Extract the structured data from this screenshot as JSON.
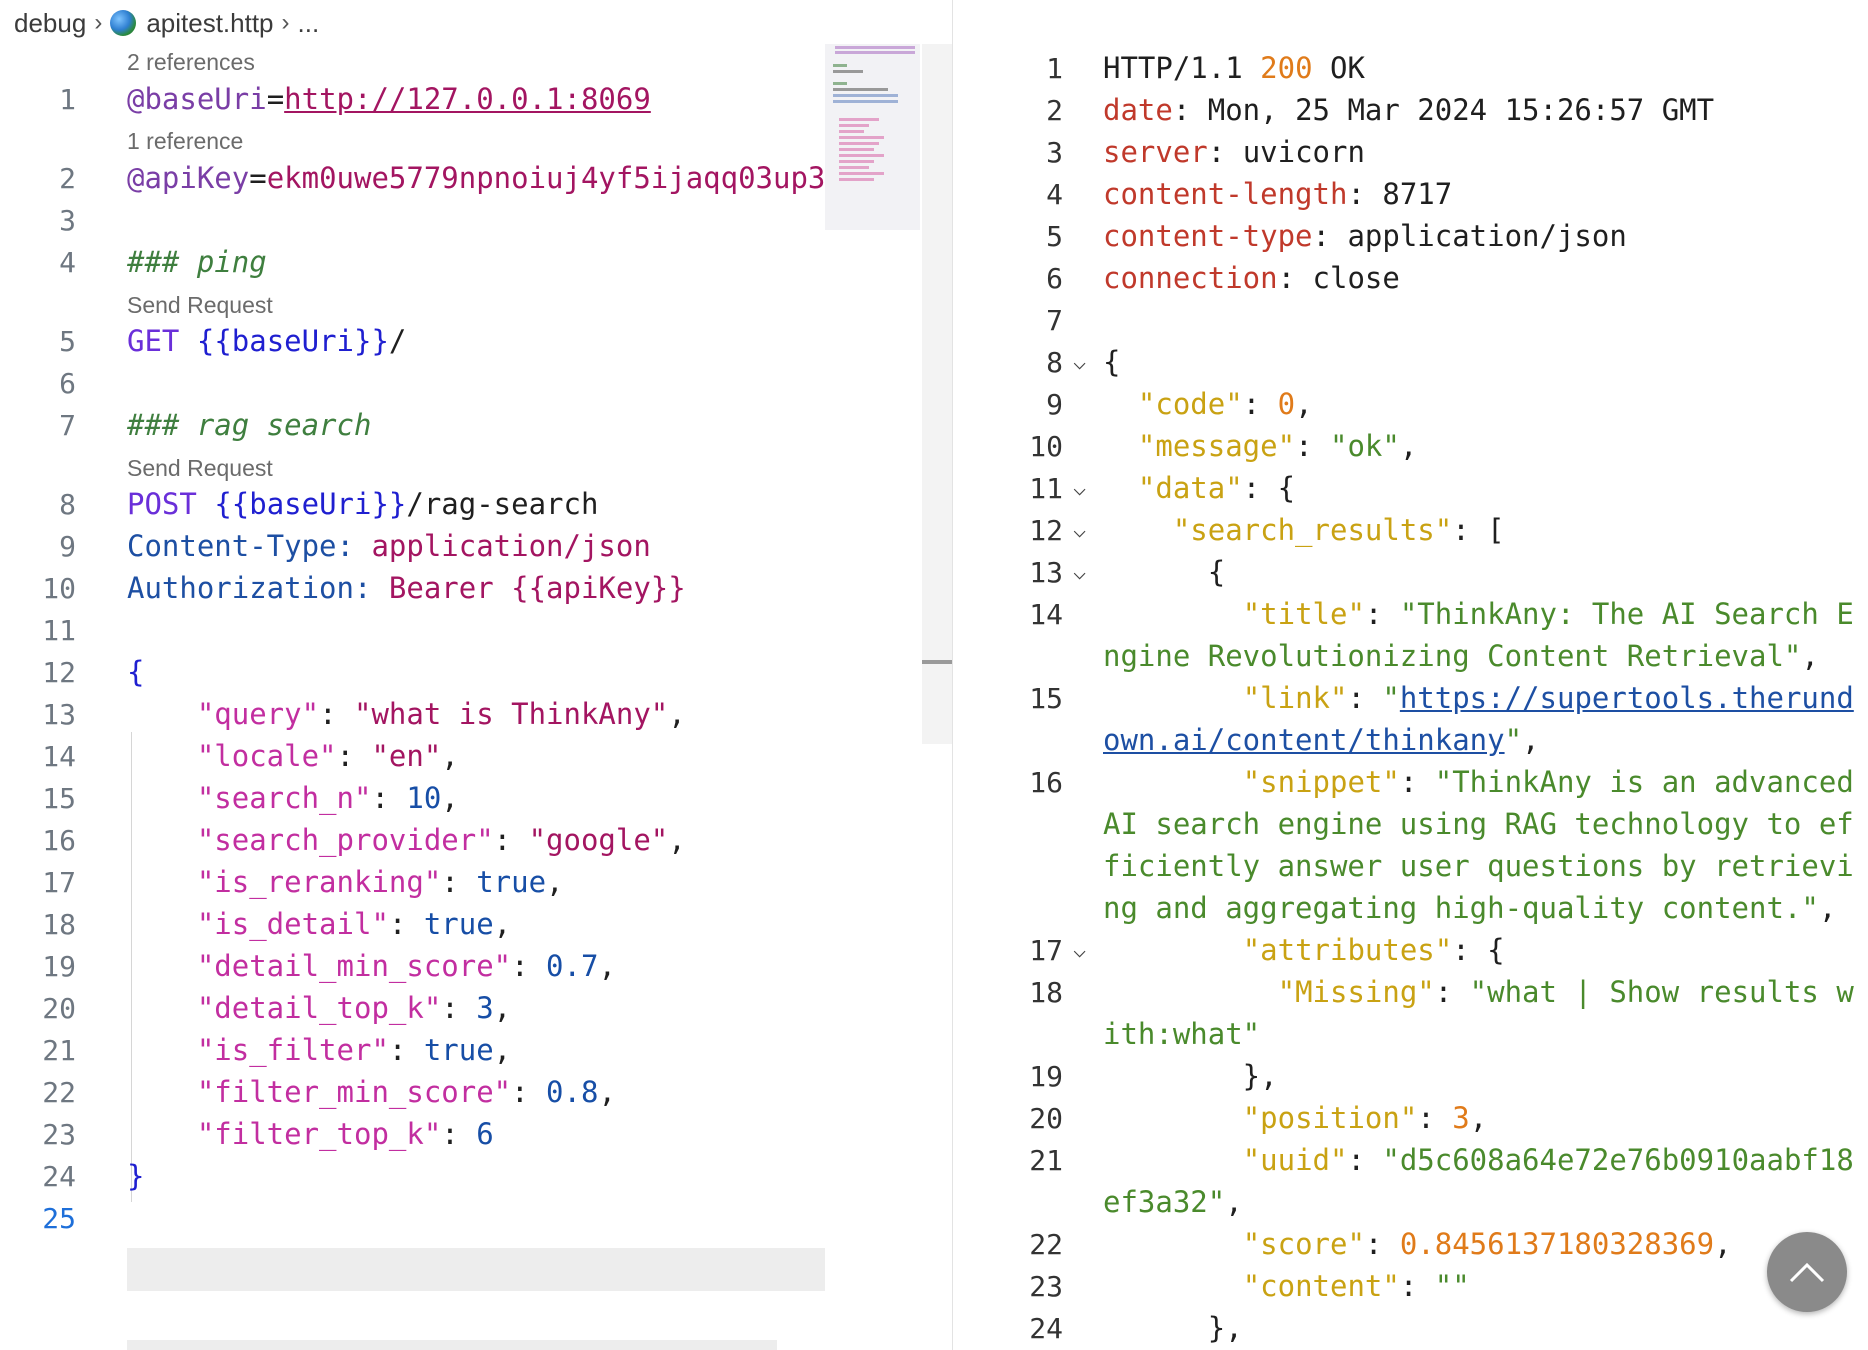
{
  "breadcrumb": {
    "folder": "debug",
    "file": "apitest.http",
    "more": "..."
  },
  "left": {
    "lens": {
      "refs_2": "2 references",
      "refs_1": "1 reference",
      "send_1": "Send Request",
      "send_2": "Send Request"
    },
    "line_numbers": [
      "1",
      "2",
      "3",
      "4",
      "5",
      "6",
      "7",
      "8",
      "9",
      "10",
      "11",
      "12",
      "13",
      "14",
      "15",
      "16",
      "17",
      "18",
      "19",
      "20",
      "21",
      "22",
      "23",
      "24",
      "25"
    ],
    "code": {
      "l1_var": "@baseUri",
      "l1_eq": "=",
      "l1_url": "http://127.0.0.1:8069",
      "l2_var": "@apiKey",
      "l2_eq": "=",
      "l2_val": "ekm0uwe5779npnoiuj4yf5ijaqq03up3",
      "l4": "### ping",
      "l5_method": "GET",
      "l5_tmpl": "{{baseUri}}",
      "l5_path": "/",
      "l7": "### rag search",
      "l8_method": "POST",
      "l8_tmpl": "{{baseUri}}",
      "l8_path": "/rag-search",
      "l9_name": "Content-Type:",
      "l9_val": "application/json",
      "l10_name": "Authorization:",
      "l10_val": "Bearer {{apiKey}}",
      "l12": "{",
      "body": [
        {
          "key": "\"query\"",
          "val": "\"what is ThinkAny\"",
          "kind": "str",
          "comma": ","
        },
        {
          "key": "\"locale\"",
          "val": "\"en\"",
          "kind": "str",
          "comma": ","
        },
        {
          "key": "\"search_n\"",
          "val": "10",
          "kind": "num",
          "comma": ","
        },
        {
          "key": "\"search_provider\"",
          "val": "\"google\"",
          "kind": "str",
          "comma": ","
        },
        {
          "key": "\"is_reranking\"",
          "val": "true",
          "kind": "num",
          "comma": ","
        },
        {
          "key": "\"is_detail\"",
          "val": "true",
          "kind": "num",
          "comma": ","
        },
        {
          "key": "\"detail_min_score\"",
          "val": "0.7",
          "kind": "num",
          "comma": ","
        },
        {
          "key": "\"detail_top_k\"",
          "val": "3",
          "kind": "num",
          "comma": ","
        },
        {
          "key": "\"is_filter\"",
          "val": "true",
          "kind": "num",
          "comma": ","
        },
        {
          "key": "\"filter_min_score\"",
          "val": "0.8",
          "kind": "num",
          "comma": ","
        },
        {
          "key": "\"filter_top_k\"",
          "val": "6",
          "kind": "num",
          "comma": ""
        }
      ],
      "l24": "}"
    }
  },
  "right": {
    "line_numbers": [
      "1",
      "2",
      "3",
      "4",
      "5",
      "6",
      "7",
      "8",
      "9",
      "10",
      "11",
      "12",
      "13",
      "14",
      "15",
      "16",
      "17",
      "18",
      "19",
      "20",
      "21",
      "22",
      "23",
      "24"
    ],
    "status": {
      "proto": "HTTP/1.1",
      "code": "200",
      "text": "OK"
    },
    "headers": [
      {
        "name": "date",
        "value": "Mon, 25 Mar 2024 15:26:57 GMT"
      },
      {
        "name": "server",
        "value": "uvicorn"
      },
      {
        "name": "content-length",
        "value": "8717"
      },
      {
        "name": "content-type",
        "value": "application/json"
      },
      {
        "name": "connection",
        "value": "close"
      }
    ],
    "json": {
      "code_key": "\"code\"",
      "code_val": "0",
      "message_key": "\"message\"",
      "message_val": "\"ok\"",
      "data_key": "\"data\"",
      "results_key": "\"search_results\"",
      "title_key": "\"title\"",
      "title_val_1": "\"ThinkAny: The AI Search E",
      "title_val_2": "ngine Revolutionizing Content Retrieval\"",
      "link_key": "\"link\"",
      "link_val_1": "https://supertools.therund",
      "link_val_2": "own.ai/content/thinkany",
      "snippet_key": "\"snippet\"",
      "snippet_val_1": "\"ThinkAny is an advanced",
      "snippet_val_2": "AI search engine using RAG technology to ef",
      "snippet_val_3": "ficiently answer user questions by retrievi",
      "snippet_val_4": "ng and aggregating high-quality content.\"",
      "attributes_key": "\"attributes\"",
      "missing_key": "\"Missing\"",
      "missing_val_1": "\"what | Show results w",
      "missing_val_2": "ith:what\"",
      "position_key": "\"position\"",
      "position_val": "3",
      "uuid_key": "\"uuid\"",
      "uuid_val_1": "\"d5c608a64e72e76b0910aabf18",
      "uuid_val_2": "ef3a32\"",
      "score_key": "\"score\"",
      "score_val": "0.8456137180328369",
      "content_key": "\"content\"",
      "content_val": "\"\""
    }
  },
  "icons": {
    "fold": "chevron-down-icon",
    "scroll_top": "arrow-up-icon",
    "file": "globe-icon"
  }
}
